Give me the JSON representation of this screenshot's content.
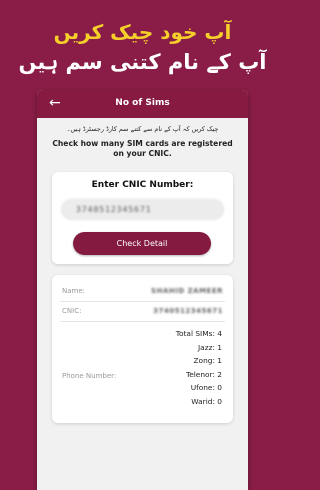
{
  "promo": {
    "line1": "آپ خود چیک کریں",
    "line2": "آپ کے نام کتنی سم ہیں"
  },
  "appbar": {
    "title": "No of Sims",
    "back_icon": "arrow-left-icon"
  },
  "intro": {
    "urdu": "چیک کریں کہ آپ کے نام سے کتنے سم کارڈ رجسٹرڈ ہیں۔",
    "english": "Check how many SIM cards are registered on your CNIC."
  },
  "form": {
    "label": "Enter CNIC Number:",
    "input_value": "3740512345671",
    "button_label": "Check Detail"
  },
  "result": {
    "name_label": "Name:",
    "name_value": "SHAHID ZAMEER",
    "cnic_label": "CNIC:",
    "cnic_value": "3740512345671",
    "phone_label": "Phone Number:",
    "counts": [
      "Total SIMs: 4",
      "Jazz: 1",
      "Zong: 1",
      "Telenor: 2",
      "Ufone: 0",
      "Warid: 0"
    ]
  },
  "colors": {
    "background": "#8a1d47",
    "accent": "#841a40",
    "promo_yellow": "#f5cf2a"
  }
}
